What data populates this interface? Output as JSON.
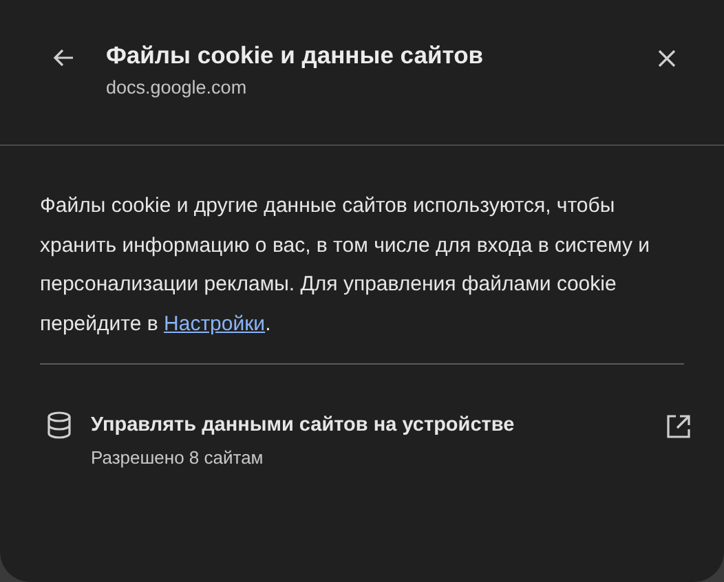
{
  "header": {
    "title": "Файлы cookie и данные сайтов",
    "subtitle": "docs.google.com"
  },
  "description": {
    "text_before": "Файлы cookie и другие данные сайтов используются, чтобы хранить информацию о вас, в том числе для входа в систему и персонализации рекламы. Для управления файлами cookie перейдите в ",
    "link": "Настройки",
    "text_after": "."
  },
  "site_data": {
    "title": "Управлять данными сайтов на устройстве",
    "subtitle": "Разрешено 8 сайтам"
  }
}
